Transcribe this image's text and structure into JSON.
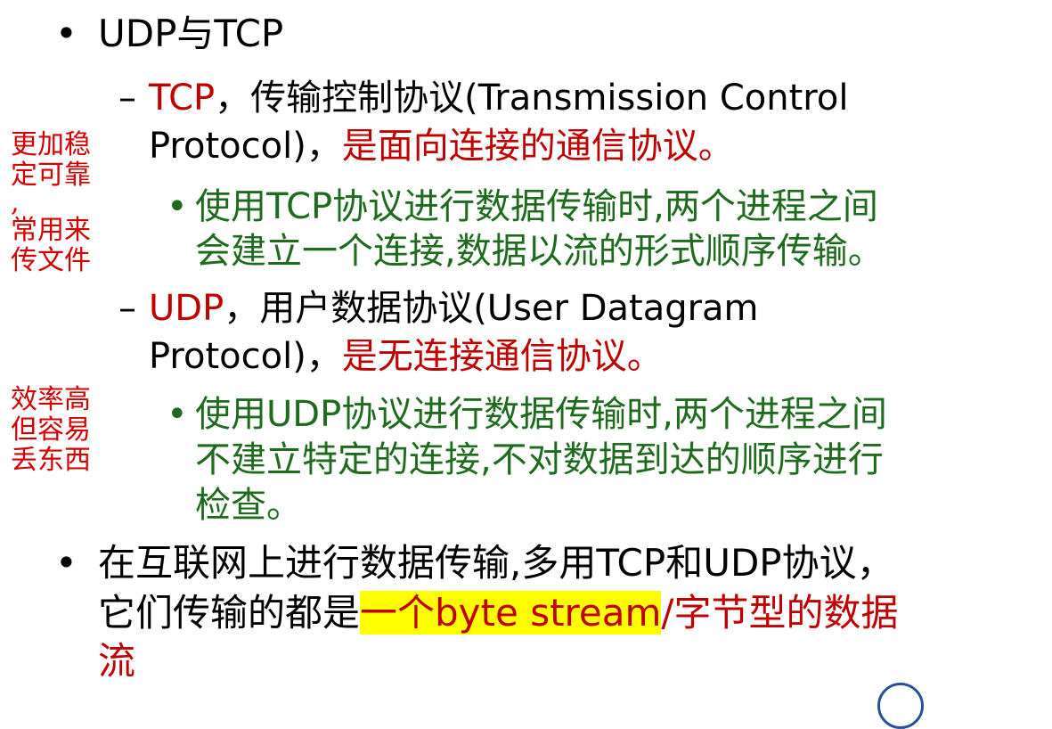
{
  "heading": {
    "bullet": "•",
    "text": "UDP与TCP"
  },
  "tcp": {
    "dash": "–",
    "name": "TCP",
    "desc_line1": "，传输控制协议(Transmission Control",
    "desc_line2": "Protocol)，",
    "emphasis": "是面向连接的通信协议。",
    "sub_bullet": "•",
    "detail_line1": "使用TCP协议进行数据传输时,两个进程之间",
    "detail_line2": "会建立一个连接,数据以流的形式顺序传输。"
  },
  "udp": {
    "dash": "–",
    "name": "UDP",
    "desc_line1": "，用户数据协议(User Datagram",
    "desc_line2": "Protocol)，",
    "emphasis": "是无连接通信协议。",
    "sub_bullet": "•",
    "detail_line1": "使用UDP协议进行数据传输时,两个进程之间",
    "detail_line2": "不建立特定的连接,不对数据到达的顺序进行",
    "detail_line3": "检查。"
  },
  "summary": {
    "bullet": "•",
    "line1": "在互联网上进行数据传输,多用TCP和UDP协议，",
    "line2_black": "它们传输的都是",
    "line2_highlight": "一个byte stream",
    "line2_red": "/字节型的数据",
    "line3_red": "流"
  },
  "annotations": {
    "tcp_note": [
      "更加稳",
      "定可靠",
      ",",
      "常用来",
      "传文件"
    ],
    "udp_note": [
      "效率高",
      "但容易",
      "丢东西"
    ]
  },
  "colors": {
    "emphasis_red": "#c00000",
    "detail_green": "#1e6b1e",
    "highlight_yellow": "#ffff00",
    "annotation_red": "#d40000"
  }
}
